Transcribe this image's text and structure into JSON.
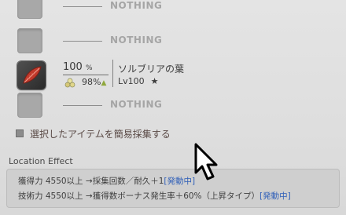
{
  "slots": [
    {
      "label": "NOTHING"
    },
    {
      "label": "NOTHING"
    },
    {
      "percent": "100",
      "percent_unit": "%",
      "hq_percent": "98",
      "hq_unit": "%",
      "name": "ソルブリアの葉",
      "level": "Lv100",
      "star": "★"
    },
    {
      "label": "NOTHING"
    }
  ],
  "quick_gather": {
    "label": "選択したアイテムを簡易採集する",
    "checked": false
  },
  "location_effect": {
    "title": "Location Effect",
    "line1": "獲得力 4550以上 →採集回数／耐久＋1",
    "line1_status": "[発動中]",
    "line2": "技術力 4550以上 →獲得数ボーナス発生率＋60%（上昇タイプ）",
    "line2_status": "[発動中]"
  },
  "colors": {
    "active": "#2f5fb8",
    "hq_indicator": "#8fa83c",
    "item_icon": "#c0392b"
  }
}
